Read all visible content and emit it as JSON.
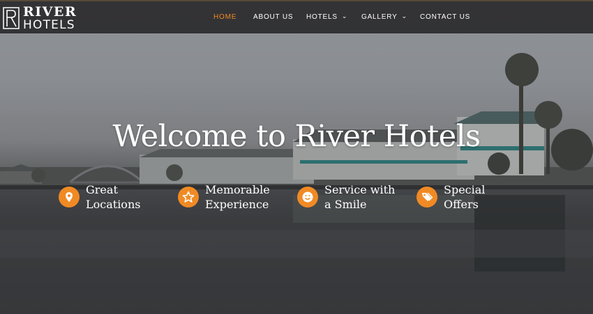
{
  "header": {
    "logo": {
      "line1": "RIVER",
      "line2": "HOTELS",
      "icon": "river-hotels-logo-mark"
    },
    "nav": [
      {
        "label": "HOME",
        "active": true,
        "dropdown": false
      },
      {
        "label": "ABOUT US",
        "active": false,
        "dropdown": false
      },
      {
        "label": "HOTELS",
        "active": false,
        "dropdown": true
      },
      {
        "label": "GALLERY",
        "active": false,
        "dropdown": true
      },
      {
        "label": "CONTACT US",
        "active": false,
        "dropdown": false
      }
    ]
  },
  "hero": {
    "title": "Welcome to River Hotels",
    "features": [
      {
        "line1": "Great",
        "line2": "Locations",
        "icon": "map-pin-icon"
      },
      {
        "line1": "Memorable",
        "line2": "Experience",
        "icon": "star-icon"
      },
      {
        "line1": "Service with",
        "line2": "a Smile",
        "icon": "smile-icon"
      },
      {
        "line1": "Special",
        "line2": "Offers",
        "icon": "tags-icon"
      }
    ]
  },
  "colors": {
    "accent": "#f08a24",
    "nav_bg": "#1e1e20",
    "text": "#ffffff"
  }
}
